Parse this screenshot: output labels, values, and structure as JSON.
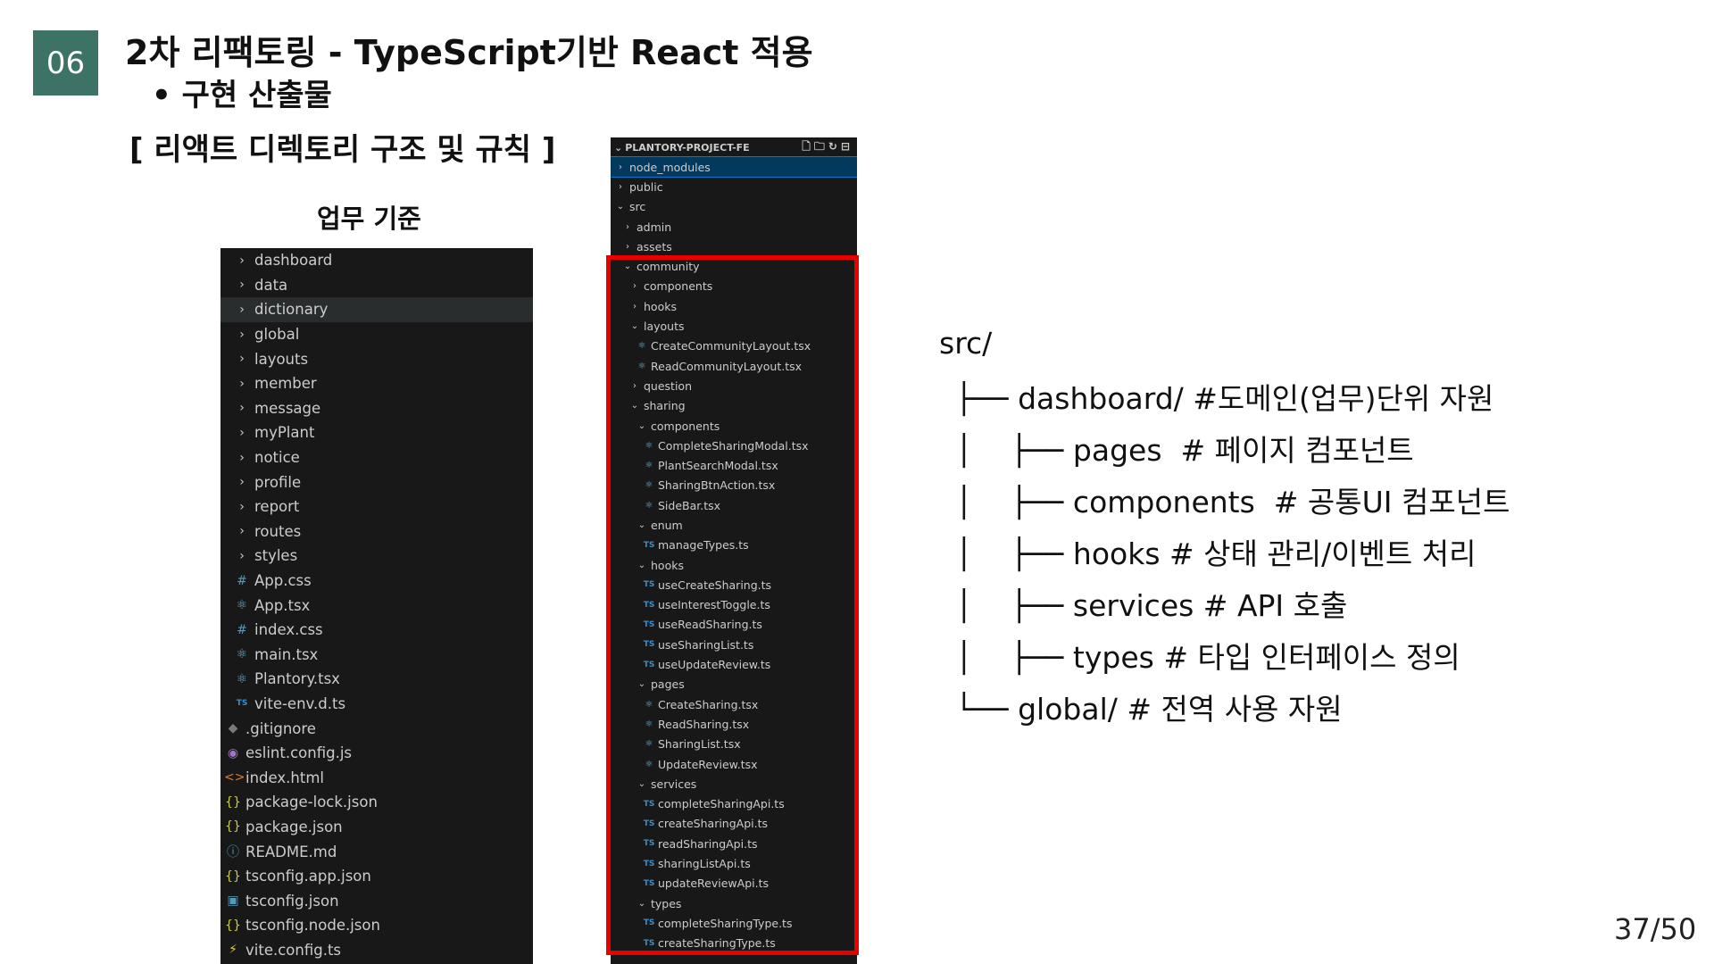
{
  "slide": {
    "badge": "06",
    "title": "2차 리팩토링 - TypeScript기반 React 적용",
    "subtitle": "• 구현 산출물",
    "section": "[ 리액트 디렉토리 구조 및 규칙 ]",
    "caption": "업무 기준",
    "page_number": "37/50"
  },
  "left_tree": [
    {
      "name": "dashboard",
      "icon": "chevron-right-icon",
      "depth": 0
    },
    {
      "name": "data",
      "icon": "chevron-right-icon",
      "depth": 0
    },
    {
      "name": "dictionary",
      "icon": "chevron-right-icon",
      "depth": 0,
      "selected": true
    },
    {
      "name": "global",
      "icon": "chevron-right-icon",
      "depth": 0
    },
    {
      "name": "layouts",
      "icon": "chevron-right-icon",
      "depth": 0
    },
    {
      "name": "member",
      "icon": "chevron-right-icon",
      "depth": 0
    },
    {
      "name": "message",
      "icon": "chevron-right-icon",
      "depth": 0
    },
    {
      "name": "myPlant",
      "icon": "chevron-right-icon",
      "depth": 0
    },
    {
      "name": "notice",
      "icon": "chevron-right-icon",
      "depth": 0
    },
    {
      "name": "profile",
      "icon": "chevron-right-icon",
      "depth": 0
    },
    {
      "name": "report",
      "icon": "chevron-right-icon",
      "depth": 0
    },
    {
      "name": "routes",
      "icon": "chevron-right-icon",
      "depth": 0
    },
    {
      "name": "styles",
      "icon": "chevron-right-icon",
      "depth": 0
    },
    {
      "name": "App.css",
      "icon": "css-icon",
      "depth": 0
    },
    {
      "name": "App.tsx",
      "icon": "react-icon",
      "depth": 0
    },
    {
      "name": "index.css",
      "icon": "css-icon",
      "depth": 0
    },
    {
      "name": "main.tsx",
      "icon": "react-icon",
      "depth": 0
    },
    {
      "name": "Plantory.tsx",
      "icon": "react-icon",
      "depth": 0
    },
    {
      "name": "vite-env.d.ts",
      "icon": "ts-icon",
      "depth": 0
    },
    {
      "name": ".gitignore",
      "icon": "git-icon",
      "depth": -1
    },
    {
      "name": "eslint.config.js",
      "icon": "eslint-icon",
      "depth": -1
    },
    {
      "name": "index.html",
      "icon": "html-icon",
      "depth": -1
    },
    {
      "name": "package-lock.json",
      "icon": "json-icon",
      "depth": -1
    },
    {
      "name": "package.json",
      "icon": "json-icon",
      "depth": -1
    },
    {
      "name": "README.md",
      "icon": "info-icon",
      "depth": -1
    },
    {
      "name": "tsconfig.app.json",
      "icon": "json-icon",
      "depth": -1
    },
    {
      "name": "tsconfig.json",
      "icon": "tsconfig-icon",
      "depth": -1
    },
    {
      "name": "tsconfig.node.json",
      "icon": "json-icon",
      "depth": -1
    },
    {
      "name": "vite.config.ts",
      "icon": "vite-icon",
      "depth": -1
    }
  ],
  "right_tree": {
    "header": "PLANTORY-PROJECT-FE",
    "rows": [
      {
        "name": "node_modules",
        "icon": "chevron-right-icon",
        "depth": 0,
        "selected": true
      },
      {
        "name": "public",
        "icon": "chevron-right-icon",
        "depth": 0
      },
      {
        "name": "src",
        "icon": "chevron-down-icon",
        "depth": 0
      },
      {
        "name": "admin",
        "icon": "chevron-right-icon",
        "depth": 1
      },
      {
        "name": "assets",
        "icon": "chevron-right-icon",
        "depth": 1
      },
      {
        "name": "community",
        "icon": "chevron-down-icon",
        "depth": 1
      },
      {
        "name": "components",
        "icon": "chevron-right-icon",
        "depth": 2
      },
      {
        "name": "hooks",
        "icon": "chevron-right-icon",
        "depth": 2
      },
      {
        "name": "layouts",
        "icon": "chevron-down-icon",
        "depth": 2
      },
      {
        "name": "CreateCommunityLayout.tsx",
        "icon": "react-icon",
        "depth": 3
      },
      {
        "name": "ReadCommunityLayout.tsx",
        "icon": "react-icon",
        "depth": 3
      },
      {
        "name": "question",
        "icon": "chevron-right-icon",
        "depth": 2
      },
      {
        "name": "sharing",
        "icon": "chevron-down-icon",
        "depth": 2
      },
      {
        "name": "components",
        "icon": "chevron-down-icon",
        "depth": 3
      },
      {
        "name": "CompleteSharingModal.tsx",
        "icon": "react-icon",
        "depth": 4
      },
      {
        "name": "PlantSearchModal.tsx",
        "icon": "react-icon",
        "depth": 4
      },
      {
        "name": "SharingBtnAction.tsx",
        "icon": "react-icon",
        "depth": 4
      },
      {
        "name": "SideBar.tsx",
        "icon": "react-icon",
        "depth": 4
      },
      {
        "name": "enum",
        "icon": "chevron-down-icon",
        "depth": 3
      },
      {
        "name": "manageTypes.ts",
        "icon": "ts-icon",
        "depth": 4
      },
      {
        "name": "hooks",
        "icon": "chevron-down-icon",
        "depth": 3
      },
      {
        "name": "useCreateSharing.ts",
        "icon": "ts-icon",
        "depth": 4
      },
      {
        "name": "useInterestToggle.ts",
        "icon": "ts-icon",
        "depth": 4
      },
      {
        "name": "useReadSharing.ts",
        "icon": "ts-icon",
        "depth": 4
      },
      {
        "name": "useSharingList.ts",
        "icon": "ts-icon",
        "depth": 4
      },
      {
        "name": "useUpdateReview.ts",
        "icon": "ts-icon",
        "depth": 4
      },
      {
        "name": "pages",
        "icon": "chevron-down-icon",
        "depth": 3
      },
      {
        "name": "CreateSharing.tsx",
        "icon": "react-icon",
        "depth": 4
      },
      {
        "name": "ReadSharing.tsx",
        "icon": "react-icon",
        "depth": 4
      },
      {
        "name": "SharingList.tsx",
        "icon": "react-icon",
        "depth": 4
      },
      {
        "name": "UpdateReview.tsx",
        "icon": "react-icon",
        "depth": 4
      },
      {
        "name": "services",
        "icon": "chevron-down-icon",
        "depth": 3
      },
      {
        "name": "completeSharingApi.ts",
        "icon": "ts-icon",
        "depth": 4
      },
      {
        "name": "createSharingApi.ts",
        "icon": "ts-icon",
        "depth": 4
      },
      {
        "name": "readSharingApi.ts",
        "icon": "ts-icon",
        "depth": 4
      },
      {
        "name": "sharingListApi.ts",
        "icon": "ts-icon",
        "depth": 4
      },
      {
        "name": "updateReviewApi.ts",
        "icon": "ts-icon",
        "depth": 4
      },
      {
        "name": "types",
        "icon": "chevron-down-icon",
        "depth": 3
      },
      {
        "name": "completeSharingType.ts",
        "icon": "ts-icon",
        "depth": 4
      },
      {
        "name": "createSharingType.ts",
        "icon": "ts-icon",
        "depth": 4
      }
    ]
  },
  "structure_text": [
    "src/",
    "├── dashboard/ #도메인(업무)단위 자원",
    "│    ├── pages  # 페이지 컴포넌트",
    "│    ├── components  # 공통UI 컴포넌트",
    "│    ├── hooks # 상태 관리/이벤트 처리",
    "│    ├── services # API 호출",
    "│    ├── types # 타입 인터페이스 정의",
    "└── global/ # 전역 사용 자원"
  ],
  "colors": {
    "badge_bg": "#3c7366",
    "explorer_bg": "#181818",
    "highlight_box": "#e60000",
    "selected_row": "#04395e"
  }
}
